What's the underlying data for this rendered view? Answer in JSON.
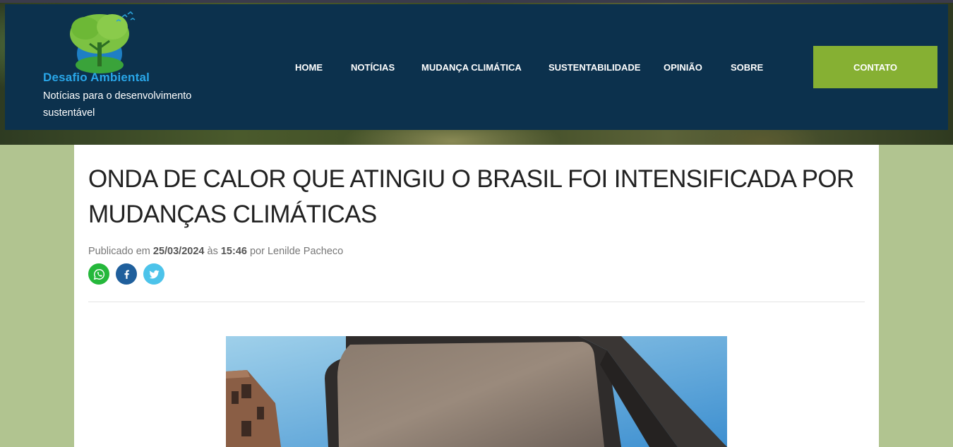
{
  "header": {
    "logo_name": "Desafio Ambiental",
    "tagline": "Notícias para o desenvolvimento sustentável",
    "nav": [
      "HOME",
      "NOTÍCIAS",
      "MUDANÇA CLIMÁTICA",
      "SUSTENTABILIDADE",
      "OPINIÃO",
      "SOBRE"
    ],
    "cta_label": "CONTATO"
  },
  "article": {
    "title": "ONDA DE CALOR QUE ATINGIU O BRASIL FOI INTENSIFICADA POR MUDANÇAS CLIMÁTICAS",
    "meta": {
      "published_prefix": "Publicado em",
      "date": "25/03/2024",
      "time_prefix": "às",
      "time": "15:46",
      "author_prefix": "por",
      "author": "Lenilde Pacheco"
    },
    "share_buttons": [
      {
        "name": "whatsapp",
        "icon": "whatsapp-icon",
        "color": "#25b83b"
      },
      {
        "name": "facebook",
        "icon": "facebook-icon",
        "color": "#1f5f9c"
      },
      {
        "name": "twitter",
        "icon": "twitter-icon",
        "color": "#4cc3ea"
      }
    ]
  },
  "colors": {
    "header_bg": "#0c314d",
    "logo_text": "#29a6e8",
    "cta_bg": "#86b033",
    "page_bg": "#b1c490"
  }
}
